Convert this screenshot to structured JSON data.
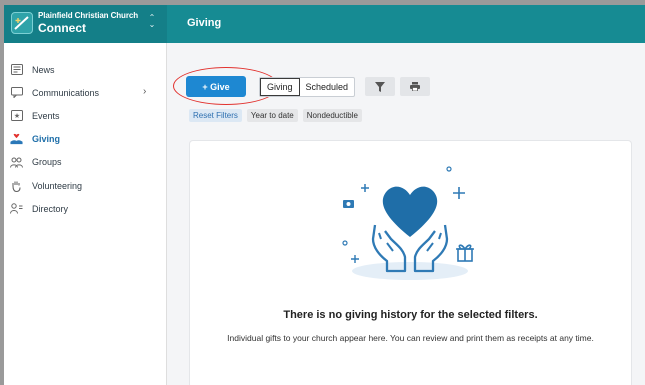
{
  "org": {
    "name": "Plainfield Christian Church",
    "app_name": "Connect"
  },
  "sidebar": {
    "items": [
      {
        "label": "News",
        "icon": "newspaper-icon"
      },
      {
        "label": "Communications",
        "icon": "chat-icon",
        "has_submenu": true
      },
      {
        "label": "Events",
        "icon": "calendar-star-icon"
      },
      {
        "label": "Giving",
        "icon": "heart-hand-icon",
        "active": true
      },
      {
        "label": "Groups",
        "icon": "people-icon"
      },
      {
        "label": "Volunteering",
        "icon": "hand-icon"
      },
      {
        "label": "Directory",
        "icon": "person-list-icon"
      }
    ]
  },
  "header": {
    "title": "Giving"
  },
  "toolbar": {
    "give_label": "+ Give",
    "tabs": [
      "Giving",
      "Scheduled"
    ],
    "selected_tab": "Giving",
    "filter_icon": "funnel-icon",
    "print_icon": "printer-icon"
  },
  "filters": {
    "reset_label": "Reset Filters",
    "chips": [
      "Year to date",
      "Nondeductible"
    ]
  },
  "empty_state": {
    "title": "There is no giving history for the selected filters.",
    "description": "Individual gifts to your church appear here. You can review and print them as receipts at any time."
  },
  "colors": {
    "brand_teal": "#168b93",
    "primary_blue": "#1e88d2",
    "annotation_red": "#e2322e",
    "heart_blue": "#1f6ea8"
  }
}
